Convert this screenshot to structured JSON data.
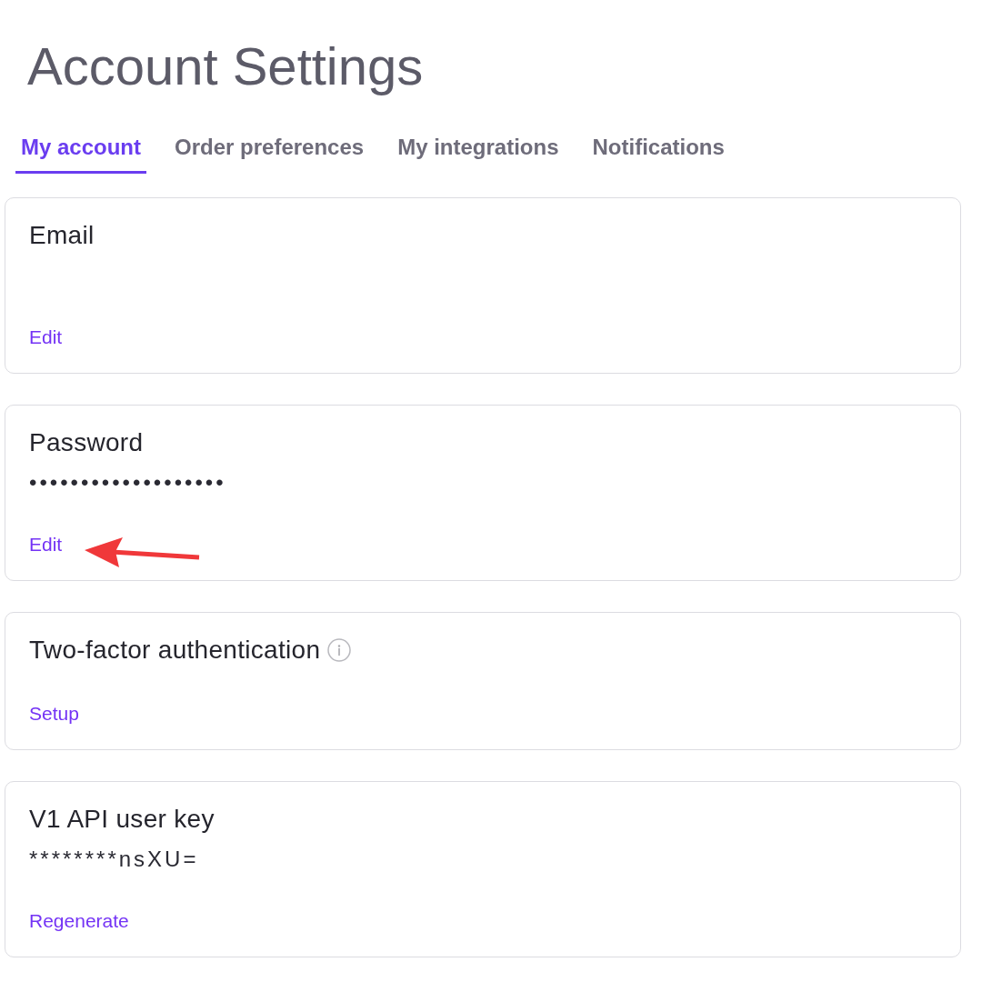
{
  "page": {
    "title": "Account Settings"
  },
  "tabs": [
    {
      "label": "My account",
      "selected": true
    },
    {
      "label": "Order preferences",
      "selected": false
    },
    {
      "label": "My integrations",
      "selected": false
    },
    {
      "label": "Notifications",
      "selected": false
    }
  ],
  "cards": [
    {
      "kind": "value",
      "title": "Email",
      "info": false,
      "action": {
        "label": "Edit",
        "marked": false
      }
    },
    {
      "kind": "value",
      "title": "Password",
      "info": false,
      "value": "•••••••••••••••••••",
      "action": {
        "label": "Edit",
        "marked": true
      }
    },
    {
      "kind": "plain",
      "title": "Two-factor authentication",
      "info": true,
      "action": {
        "label": "Setup",
        "marked": false
      }
    },
    {
      "kind": "value",
      "title": "V1 API user key",
      "info": false,
      "value": "********nsXU=",
      "action": {
        "label": "Regenerate",
        "marked": false
      }
    }
  ]
}
